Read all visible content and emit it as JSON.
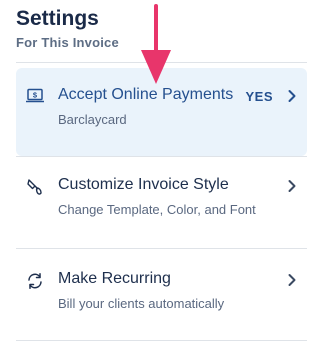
{
  "header": {
    "title": "Settings",
    "subtitle": "For This Invoice"
  },
  "items": [
    {
      "label": "Accept Online Payments",
      "description": "Barclaycard",
      "status": "YES",
      "icon": "laptop-dollar-icon",
      "active": true
    },
    {
      "label": "Customize Invoice Style",
      "description": "Change Template, Color, and Font",
      "icon": "paint-brush-icon"
    },
    {
      "label": "Make Recurring",
      "description": "Bill your clients automatically",
      "icon": "recurring-icon"
    }
  ],
  "colors": {
    "accent": "#25508f",
    "active_bg": "#eaf3fb",
    "annotation_arrow": "#e8356b"
  }
}
